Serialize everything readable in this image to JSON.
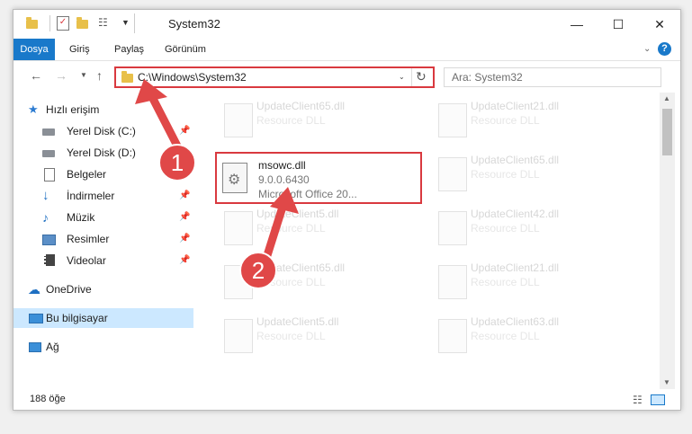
{
  "window": {
    "title": "System32",
    "minimize": "—",
    "maximize": "☐",
    "close": "✕"
  },
  "ribbon": {
    "file_tab": "Dosya",
    "tabs": [
      "Giriş",
      "Paylaş",
      "Görünüm"
    ]
  },
  "address": {
    "path": "C:\\Windows\\System32",
    "search_placeholder": "Ara: System32"
  },
  "nav": {
    "quick_access": "Hızlı erişim",
    "items": [
      {
        "label": "Yerel Disk (C:)",
        "icon": "drive-icon"
      },
      {
        "label": "Yerel Disk (D:)",
        "icon": "drive-icon"
      },
      {
        "label": "Belgeler",
        "icon": "documents-icon"
      },
      {
        "label": "İndirmeler",
        "icon": "download-icon"
      },
      {
        "label": "Müzik",
        "icon": "music-icon"
      },
      {
        "label": "Resimler",
        "icon": "pictures-icon"
      },
      {
        "label": "Videolar",
        "icon": "videos-icon"
      }
    ],
    "onedrive": "OneDrive",
    "this_pc": "Bu bilgisayar",
    "network": "Ağ"
  },
  "files": {
    "highlighted": {
      "name": "msowc.dll",
      "version": "9.0.0.6430",
      "desc": "Microsoft Office 20..."
    },
    "faded": [
      {
        "name": "UpdateClient65.dll",
        "desc": "Resource DLL"
      },
      {
        "name": "UpdateClient21.dll",
        "desc": "Resource DLL"
      },
      {
        "name": "UpdateClient65.dll",
        "desc": "Resource DLL"
      },
      {
        "name": "UpdateClient5.dll",
        "desc": "Resource DLL"
      },
      {
        "name": "UpdateClient42.dll",
        "desc": "Resource DLL"
      },
      {
        "name": "UpdateClient65.dll",
        "desc": "Resource DLL"
      },
      {
        "name": "UpdateClient21.dll",
        "desc": "Resource DLL"
      },
      {
        "name": "UpdateClient5.dll",
        "desc": "Resource DLL"
      },
      {
        "name": "UpdateClient63.dll",
        "desc": "Resource DLL"
      }
    ]
  },
  "annotations": {
    "step1": "1",
    "step2": "2"
  },
  "status": {
    "count": "188 öğe"
  },
  "colors": {
    "accent": "#1979ca",
    "highlight": "#d9393f",
    "selected": "#cce8ff"
  }
}
